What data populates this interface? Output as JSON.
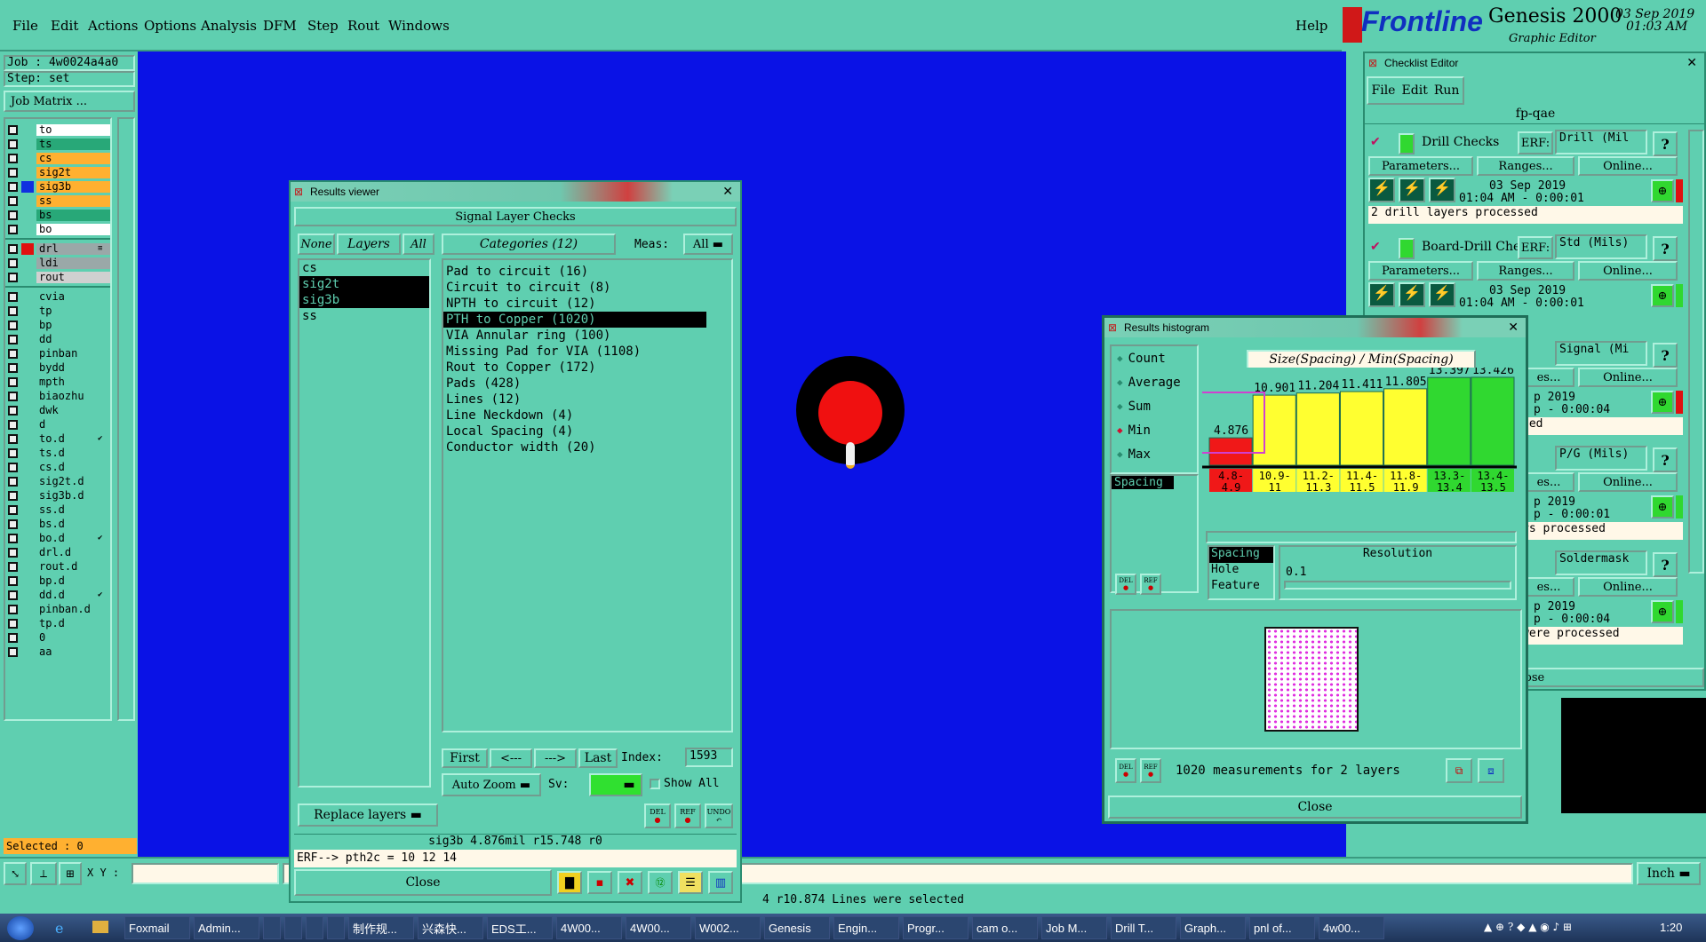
{
  "menu": {
    "file": "File",
    "edit": "Edit",
    "actions": "Actions",
    "options": "Options",
    "analysis": "Analysis",
    "dfm": "DFM",
    "step": "Step",
    "rout": "Rout",
    "windows": "Windows",
    "help": "Help"
  },
  "brand": {
    "logo": "Frontline",
    "product": "Genesis 2000",
    "subtitle": "Graphic Editor",
    "date": "03 Sep 2019",
    "time": "01:03 AM"
  },
  "job": {
    "job": "Job : 4w0024a4a0",
    "step": "Step: set",
    "matrix_btn": "Job Matrix ..."
  },
  "layers_top": [
    {
      "name": "to",
      "color": "#ffffff"
    },
    {
      "name": "ts",
      "color": "#28a878"
    },
    {
      "name": "cs",
      "color": "#ffb030"
    },
    {
      "name": "sig2t",
      "color": "#ffb030"
    },
    {
      "name": "sig3b",
      "color": "#ffb030",
      "swatch": "#1030e0"
    },
    {
      "name": "ss",
      "color": "#ffb030"
    },
    {
      "name": "bs",
      "color": "#28a878"
    },
    {
      "name": "bo",
      "color": "#ffffff"
    }
  ],
  "layers_mid": [
    {
      "name": "drl",
      "color": "#9aa8a8",
      "swatch": "#e01010",
      "mark": "≡"
    },
    {
      "name": "ldi",
      "color": "#9aa8a8"
    },
    {
      "name": "rout",
      "color": "#d0d0d0"
    }
  ],
  "layers_bottom": [
    {
      "name": "cvia"
    },
    {
      "name": "tp"
    },
    {
      "name": "bp"
    },
    {
      "name": "dd"
    },
    {
      "name": "pinban"
    },
    {
      "name": "bydd"
    },
    {
      "name": "mpth"
    },
    {
      "name": "biaozhu"
    },
    {
      "name": "dwk"
    },
    {
      "name": "d"
    },
    {
      "name": "to.d",
      "mark": "✔"
    },
    {
      "name": "ts.d"
    },
    {
      "name": "cs.d"
    },
    {
      "name": "sig2t.d"
    },
    {
      "name": "sig3b.d"
    },
    {
      "name": "ss.d"
    },
    {
      "name": "bs.d"
    },
    {
      "name": "bo.d",
      "mark": "✔"
    },
    {
      "name": "drl.d"
    },
    {
      "name": "rout.d"
    },
    {
      "name": "bp.d"
    },
    {
      "name": "dd.d",
      "mark": "✔"
    },
    {
      "name": "pinban.d"
    },
    {
      "name": "tp.d"
    },
    {
      "name": "0"
    },
    {
      "name": "aa"
    }
  ],
  "status": {
    "selected": "Selected : 0",
    "xy_label": "X Y :",
    "xy_value": "",
    "units": "Inch",
    "message": "4 r10.874 Lines were selected"
  },
  "results_viewer": {
    "title": "Results viewer",
    "header": "Signal Layer Checks",
    "none": "None",
    "layers": "Layers",
    "all": "All",
    "categories": "Categories (12)",
    "meas_label": "Meas:",
    "meas_value": "All",
    "layer_list": [
      "cs",
      "sig2t",
      "sig3b",
      "ss"
    ],
    "category_list": [
      "Pad to circuit (16)",
      "Circuit to circuit (8)",
      "NPTH to circuit (12)",
      "PTH to Copper (1020)",
      "VIA Annular ring (100)",
      "Missing Pad for VIA (1108)",
      "Rout to Copper (172)",
      "Pads (428)",
      "Lines (12)",
      "Line Neckdown (4)",
      "Local Spacing (4)",
      "Conductor width (20)"
    ],
    "first": "First",
    "prev": "<---",
    "next": "--->",
    "last": "Last",
    "index_label": "Index:",
    "index_value": "1593",
    "auto_zoom": "Auto Zoom",
    "sv_label": "Sv:",
    "show_all": "Show All",
    "replace_layers": "Replace layers",
    "del": "DEL",
    "ref": "REF",
    "undo": "UNDO",
    "status_line": "sig3b 4.876mil  r15.748  r0",
    "erf_line": "ERF--> pth2c = 10 12 14",
    "close": "Close"
  },
  "histogram": {
    "title": "Results histogram",
    "formula": "Size(Spacing) / Min(Spacing)",
    "options": [
      "Count",
      "Average",
      "Sum",
      "Min",
      "Max"
    ],
    "selected_option": "Min",
    "tag": "Spacing",
    "types": [
      "Spacing",
      "Hole",
      "Feature"
    ],
    "resolution_label": "Resolution",
    "resolution_value": "0.1",
    "summary": "1020 measurements for 2 layers",
    "close": "Close",
    "del": "DEL",
    "ref": "REF"
  },
  "chart_data": {
    "type": "bar",
    "categories": [
      "4.8-4.9",
      "10.9-11",
      "11.2-11.3",
      "11.4-11.5",
      "11.8-11.9",
      "13.3-13.4",
      "13.4-13.5"
    ],
    "values": [
      4.876,
      10.901,
      11.204,
      11.411,
      11.805,
      13.397,
      13.426
    ],
    "labels": [
      "4.876",
      "10.901",
      "11.204",
      "11.411",
      "11.805",
      "13.397",
      "13.426"
    ],
    "colors": [
      "#f01818",
      "#ffff30",
      "#ffff30",
      "#ffff30",
      "#ffff30",
      "#30d830",
      "#30d830"
    ],
    "ylim": [
      0,
      15
    ]
  },
  "checklist": {
    "title": "Checklist Editor",
    "menus": [
      "File",
      "Edit",
      "Run"
    ],
    "name": "fp-qae",
    "checks": [
      {
        "name": "Drill Checks",
        "erf": "Drill (Mil",
        "params": "Parameters...",
        "ranges": "Ranges...",
        "online": "Online...",
        "date": "03 Sep 2019",
        "time": "01:04 AM - 0:00:01",
        "msg": "2 drill layers processed"
      },
      {
        "name": "Board-Drill Che",
        "erf": "Std (Mils)",
        "params": "Parameters...",
        "ranges": "Ranges...",
        "online": "Online...",
        "date": "03 Sep 2019",
        "time": "01:04 AM - 0:00:01",
        "msg": ""
      }
    ],
    "erf_label": "ERF:",
    "peek": [
      {
        "erf": "Signal (Mi",
        "online": "Online...",
        "date": "p 2019",
        "time": "p - 0:00:04",
        "msg": "sed"
      },
      {
        "erf": "P/G (Mils)",
        "online": "Online...",
        "date": "p 2019",
        "time": "p - 0:00:01",
        "msg": "rs processed"
      },
      {
        "erf": "Soldermask",
        "online": "Online...",
        "date": "p 2019",
        "time": "p - 0:00:04",
        "msg": "were processed"
      }
    ],
    "peek_btn": "es...",
    "close_peek": "ose"
  },
  "taskbar": {
    "items": [
      "Foxmail",
      "Admin...",
      "",
      "",
      "",
      "",
      "制作规...",
      "兴森快...",
      "EDS工...",
      "4W00...",
      "4W00...",
      "W002...",
      "Genesis",
      "Engin...",
      "Progr...",
      "cam o...",
      "Job M...",
      "Drill T...",
      "Graph...",
      "pnl of...",
      "4w00..."
    ],
    "clock": "1:20"
  }
}
